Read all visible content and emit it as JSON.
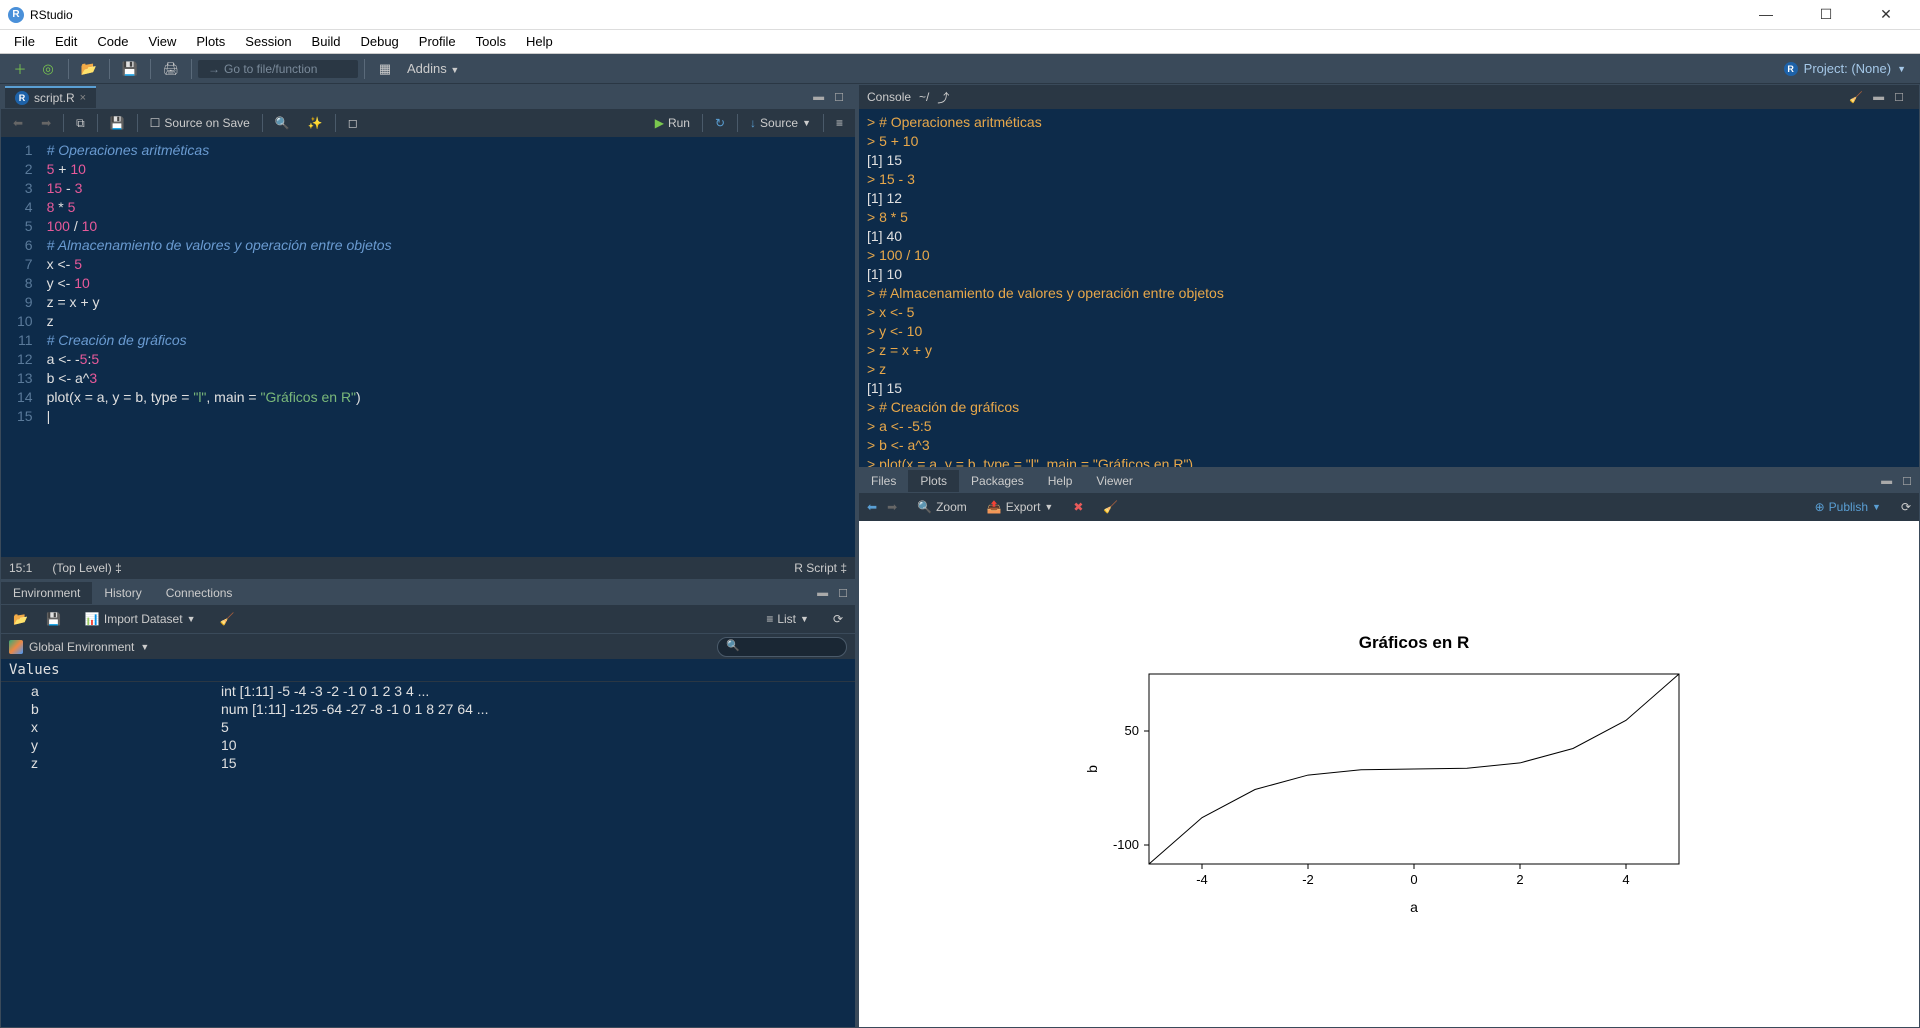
{
  "app": {
    "title": "RStudio"
  },
  "menubar": [
    "File",
    "Edit",
    "Code",
    "View",
    "Plots",
    "Session",
    "Build",
    "Debug",
    "Profile",
    "Tools",
    "Help"
  ],
  "toolbar": {
    "goto_placeholder": "Go to file/function",
    "addins": "Addins",
    "project": "Project: (None)"
  },
  "source": {
    "tab": "script.R",
    "source_on_save": "Source on Save",
    "run": "Run",
    "source_btn": "Source",
    "cursor_pos": "15:1",
    "scope": "(Top Level)",
    "file_type": "R Script",
    "lines": [
      {
        "n": 1,
        "html": "<span class='tok-comment'># Operaciones aritméticas</span>"
      },
      {
        "n": 2,
        "html": "<span class='tok-num'>5</span> <span class='tok-op'>+</span> <span class='tok-num'>10</span>"
      },
      {
        "n": 3,
        "html": "<span class='tok-num'>15</span> <span class='tok-op'>-</span> <span class='tok-num'>3</span>"
      },
      {
        "n": 4,
        "html": "<span class='tok-num'>8</span> <span class='tok-op'>*</span> <span class='tok-num'>5</span>"
      },
      {
        "n": 5,
        "html": "<span class='tok-num'>100</span> <span class='tok-op'>/</span> <span class='tok-num'>10</span>"
      },
      {
        "n": 6,
        "html": "<span class='tok-comment'># Almacenamiento de valores y operación entre objetos</span>"
      },
      {
        "n": 7,
        "html": "x <span class='tok-op'>&lt;-</span> <span class='tok-num'>5</span>"
      },
      {
        "n": 8,
        "html": "y <span class='tok-op'>&lt;-</span> <span class='tok-num'>10</span>"
      },
      {
        "n": 9,
        "html": "z <span class='tok-op'>=</span> x <span class='tok-op'>+</span> y"
      },
      {
        "n": 10,
        "html": "z"
      },
      {
        "n": 11,
        "html": "<span class='tok-comment'># Creación de gráficos</span>"
      },
      {
        "n": 12,
        "html": "a <span class='tok-op'>&lt;-</span> <span class='tok-op'>-</span><span class='tok-num'>5</span><span class='tok-op'>:</span><span class='tok-num'>5</span>"
      },
      {
        "n": 13,
        "html": "b <span class='tok-op'>&lt;-</span> a<span class='tok-op'>^</span><span class='tok-num'>3</span>"
      },
      {
        "n": 14,
        "html": "<span class='tok-fn'>plot</span>(x <span class='tok-op'>=</span> a, y <span class='tok-op'>=</span> b, type <span class='tok-op'>=</span> <span class='tok-str'>\"l\"</span>, main <span class='tok-op'>=</span> <span class='tok-str'>\"Gráficos en R\"</span>)"
      },
      {
        "n": 15,
        "html": "|"
      }
    ]
  },
  "env": {
    "tabs": [
      "Environment",
      "History",
      "Connections"
    ],
    "import": "Import Dataset",
    "view": "List",
    "scope_label": "Global Environment",
    "section": "Values",
    "vars": [
      {
        "name": "a",
        "value": "int [1:11] -5 -4 -3 -2 -1 0 1 2 3 4 ..."
      },
      {
        "name": "b",
        "value": "num [1:11] -125 -64 -27 -8 -1 0 1 8 27 64 ..."
      },
      {
        "name": "x",
        "value": "5"
      },
      {
        "name": "y",
        "value": "10"
      },
      {
        "name": "z",
        "value": "15"
      }
    ]
  },
  "console": {
    "label": "Console",
    "path": "~/",
    "lines": [
      {
        "t": "p",
        "s": "> # Operaciones aritméticas"
      },
      {
        "t": "p",
        "s": "> 5 + 10"
      },
      {
        "t": "o",
        "s": "[1] 15"
      },
      {
        "t": "p",
        "s": "> 15 - 3"
      },
      {
        "t": "o",
        "s": "[1] 12"
      },
      {
        "t": "p",
        "s": "> 8 * 5"
      },
      {
        "t": "o",
        "s": "[1] 40"
      },
      {
        "t": "p",
        "s": "> 100 / 10"
      },
      {
        "t": "o",
        "s": "[1] 10"
      },
      {
        "t": "p",
        "s": "> # Almacenamiento de valores y operación entre objetos"
      },
      {
        "t": "p",
        "s": "> x <- 5"
      },
      {
        "t": "p",
        "s": "> y <- 10"
      },
      {
        "t": "p",
        "s": "> z = x + y"
      },
      {
        "t": "p",
        "s": "> z"
      },
      {
        "t": "o",
        "s": "[1] 15"
      },
      {
        "t": "p",
        "s": "> # Creación de gráficos"
      },
      {
        "t": "p",
        "s": "> a <- -5:5"
      },
      {
        "t": "p",
        "s": "> b <- a^3"
      },
      {
        "t": "p",
        "s": "> plot(x = a, y = b, type = \"l\", main = \"Gráficos en R\")"
      },
      {
        "t": "p",
        "s": "> "
      }
    ]
  },
  "plots": {
    "tabs": [
      "Files",
      "Plots",
      "Packages",
      "Help",
      "Viewer"
    ],
    "zoom": "Zoom",
    "export": "Export",
    "publish": "Publish"
  },
  "chart_data": {
    "type": "line",
    "title": "Gráficos en R",
    "xlabel": "a",
    "ylabel": "b",
    "x": [
      -5,
      -4,
      -3,
      -2,
      -1,
      0,
      1,
      2,
      3,
      4,
      5
    ],
    "y": [
      -125,
      -64,
      -27,
      -8,
      -1,
      0,
      1,
      8,
      27,
      64,
      125
    ],
    "xlim": [
      -5,
      5
    ],
    "ylim": [
      -125,
      125
    ],
    "xticks": [
      -4,
      -2,
      0,
      2,
      4
    ],
    "yticks": [
      -100,
      50
    ]
  }
}
